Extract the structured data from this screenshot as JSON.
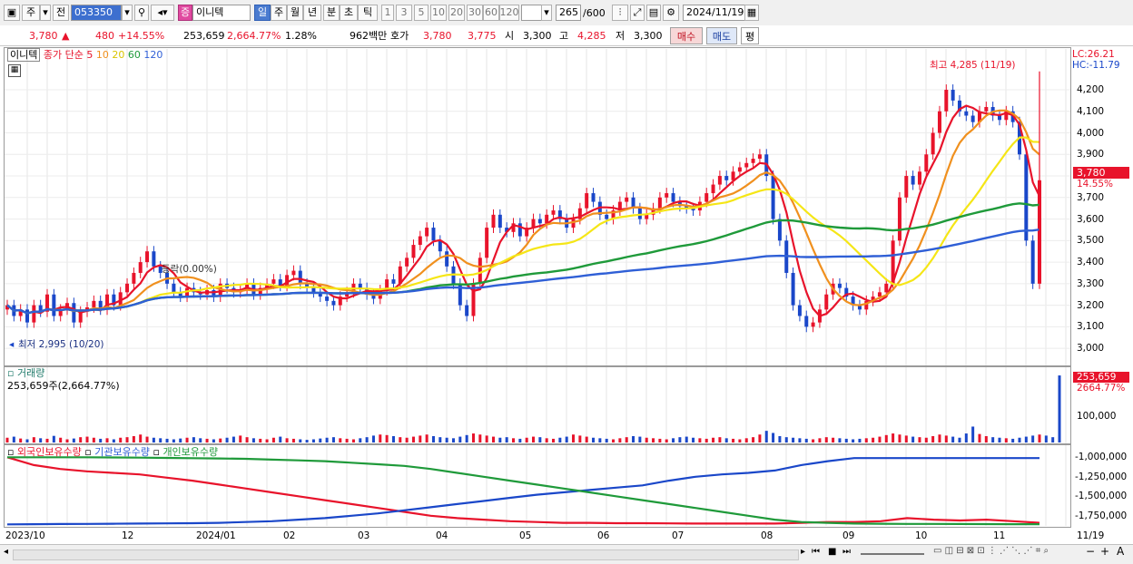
{
  "toolbar": {
    "mode_label": "주",
    "prev_label": "전",
    "code_value": "053350",
    "name_badge": "증",
    "name_value": "이니텍",
    "period_tabs": [
      "일",
      "주",
      "월",
      "년",
      "분",
      "초",
      "틱"
    ],
    "period_nums": [
      "1",
      "3",
      "5",
      "10",
      "20",
      "30",
      "60",
      "120"
    ],
    "count_value": "265",
    "count_total": "/600",
    "date_value": "2024/11/19"
  },
  "info": {
    "price": "3,780",
    "change": "480",
    "change_pct": "+14.55%",
    "volume": "253,659",
    "volume_pct": "2,664.77%",
    "turnover": "1.28%",
    "amount": "962백만",
    "quote_label": "호가",
    "quote_ask": "3,780",
    "quote_bid": "3,775",
    "open_label": "시",
    "open": "3,300",
    "high_label": "고",
    "high": "4,285",
    "low_label": "저",
    "low": "3,300",
    "buy_label": "매수",
    "sell_label": "매도",
    "avg_label": "평"
  },
  "price_pane": {
    "name": "이니텍",
    "ma_label": "종가 단순",
    "ma_periods": [
      "5",
      "10",
      "20",
      "60",
      "120"
    ],
    "lc": "LC:26.21",
    "hc": "HC:-11.79",
    "high_note": "최고 4,285 (11/19)",
    "low_note": "최저 2,995 (10/20)",
    "mid_note": "등락(0.00%)",
    "yticks": [
      "4,200",
      "4,100",
      "4,000",
      "3,900",
      "3,800",
      "3,700",
      "3,600",
      "3,500",
      "3,400",
      "3,300",
      "3,200",
      "3,100",
      "3,000"
    ],
    "cur_price_tag": "3,780",
    "cur_pct_tag": "14.55%"
  },
  "volume_pane": {
    "title": "거래량",
    "value_text": "253,659주(2,664.77%)",
    "ytick": "100,000",
    "cur_tag": "253,659",
    "cur_pct_tag": "2664.77%"
  },
  "holding_pane": {
    "legend": [
      "외국인보유수량",
      "기관보유수량",
      "개인보유수량"
    ],
    "yticks": [
      "-1,000,000",
      "-1,250,000",
      "-1,500,000",
      "-1,750,000"
    ]
  },
  "xaxis": [
    "2023/10",
    "12",
    "2024/01",
    "02",
    "03",
    "04",
    "05",
    "06",
    "07",
    "08",
    "09",
    "10",
    "11",
    "11/19"
  ],
  "colors": {
    "up": "#e8132b",
    "down": "#1a47c9",
    "ma5": "#e8132b",
    "ma10": "#f0901e",
    "ma20": "#f5e616",
    "ma60": "#1f9a3a",
    "ma120": "#2f5fd6"
  },
  "chart_data": {
    "type": "candlestick",
    "price_ylim": [
      2950,
      4280
    ],
    "close_series": [
      3200,
      3150,
      3180,
      3120,
      3200,
      3170,
      3250,
      3150,
      3180,
      3210,
      3120,
      3170,
      3190,
      3220,
      3180,
      3250,
      3200,
      3260,
      3300,
      3350,
      3400,
      3450,
      3380,
      3350,
      3300,
      3260,
      3240,
      3280,
      3260,
      3250,
      3270,
      3240,
      3300,
      3280,
      3260,
      3270,
      3300,
      3250,
      3280,
      3300,
      3320,
      3290,
      3340,
      3360,
      3300,
      3280,
      3260,
      3240,
      3220,
      3200,
      3240,
      3260,
      3300,
      3280,
      3250,
      3230,
      3270,
      3320,
      3300,
      3380,
      3420,
      3480,
      3520,
      3560,
      3500,
      3450,
      3380,
      3300,
      3200,
      3150,
      3300,
      3420,
      3560,
      3620,
      3560,
      3540,
      3580,
      3520,
      3560,
      3600,
      3580,
      3620,
      3640,
      3600,
      3560,
      3600,
      3650,
      3720,
      3680,
      3620,
      3600,
      3640,
      3680,
      3700,
      3650,
      3600,
      3620,
      3650,
      3700,
      3720,
      3680,
      3660,
      3650,
      3640,
      3680,
      3720,
      3760,
      3800,
      3780,
      3820,
      3840,
      3860,
      3880,
      3900,
      3800,
      3600,
      3500,
      3350,
      3200,
      3150,
      3100,
      3120,
      3180,
      3250,
      3300,
      3280,
      3240,
      3200,
      3180,
      3220,
      3240,
      3260,
      3300,
      3500,
      3700,
      3800,
      3760,
      3820,
      3900,
      4000,
      4100,
      4200,
      4150,
      4100,
      4080,
      4050,
      4100,
      4120,
      4080,
      4060,
      4100,
      4050,
      3900,
      3500,
      3300,
      3780
    ],
    "volume_series": [
      18,
      22,
      15,
      12,
      20,
      16,
      14,
      25,
      18,
      12,
      15,
      20,
      22,
      18,
      14,
      16,
      12,
      18,
      20,
      24,
      30,
      22,
      18,
      16,
      14,
      12,
      15,
      18,
      20,
      16,
      14,
      12,
      15,
      18,
      22,
      26,
      20,
      16,
      14,
      12,
      18,
      22,
      16,
      14,
      12,
      10,
      12,
      15,
      18,
      20,
      16,
      14,
      12,
      16,
      20,
      26,
      30,
      28,
      24,
      20,
      18,
      22,
      26,
      30,
      24,
      20,
      18,
      16,
      22,
      28,
      34,
      30,
      26,
      22,
      18,
      20,
      16,
      14,
      18,
      22,
      20,
      16,
      14,
      18,
      22,
      30,
      26,
      22,
      18,
      16,
      14,
      12,
      16,
      20,
      24,
      22,
      18,
      16,
      14,
      12,
      16,
      20,
      22,
      18,
      16,
      14,
      18,
      20,
      16,
      14,
      12,
      16,
      20,
      30,
      44,
      36,
      24,
      20,
      18,
      16,
      14,
      12,
      16,
      20,
      18,
      16,
      14,
      12,
      14,
      16,
      18,
      22,
      28,
      34,
      30,
      26,
      22,
      20,
      18,
      24,
      30,
      26,
      22,
      18,
      34,
      60,
      32,
      24,
      20,
      18,
      16,
      14,
      18,
      22,
      26,
      30,
      26,
      20,
      253
    ],
    "holding_series": [
      {
        "name": "외국인보유수량",
        "ylim": [
          -1880000,
          -950000
        ],
        "values": [
          -1000000,
          -1100000,
          -1150000,
          -1180000,
          -1200000,
          -1220000,
          -1260000,
          -1300000,
          -1350000,
          -1400000,
          -1450000,
          -1500000,
          -1550000,
          -1600000,
          -1650000,
          -1700000,
          -1750000,
          -1780000,
          -1800000,
          -1820000,
          -1830000,
          -1840000,
          -1840000,
          -1845000,
          -1845000,
          -1848000,
          -1850000,
          -1850000,
          -1850000,
          -1850000,
          -1840000,
          -1830000,
          -1830000,
          -1820000,
          -1780000,
          -1800000,
          -1810000,
          -1800000,
          -1820000,
          -1840000
        ]
      },
      {
        "name": "기관보유수량",
        "ylim": [
          -1880000,
          -950000
        ],
        "values": [
          -1860000,
          -1858000,
          -1856000,
          -1854000,
          -1852000,
          -1850000,
          -1848000,
          -1845000,
          -1840000,
          -1830000,
          -1820000,
          -1800000,
          -1780000,
          -1750000,
          -1720000,
          -1680000,
          -1640000,
          -1600000,
          -1560000,
          -1520000,
          -1480000,
          -1450000,
          -1420000,
          -1390000,
          -1360000,
          -1300000,
          -1250000,
          -1220000,
          -1200000,
          -1170000,
          -1100000,
          -1050000,
          -1010000,
          -1010000,
          -1010000,
          -1010000,
          -1010000,
          -1010000,
          -1010000,
          -1010000
        ]
      },
      {
        "name": "개인보유수량",
        "ylim": [
          -1880000,
          -950000
        ],
        "values": [
          -1000000,
          -1000000,
          -1000000,
          -1000000,
          -1002000,
          -1005000,
          -1008000,
          -1012000,
          -1015000,
          -1020000,
          -1030000,
          -1040000,
          -1050000,
          -1070000,
          -1090000,
          -1110000,
          -1150000,
          -1200000,
          -1250000,
          -1300000,
          -1350000,
          -1400000,
          -1450000,
          -1500000,
          -1550000,
          -1600000,
          -1650000,
          -1700000,
          -1750000,
          -1800000,
          -1830000,
          -1840000,
          -1850000,
          -1852000,
          -1854000,
          -1855000,
          -1856000,
          -1857000,
          -1858000,
          -1858000
        ]
      }
    ]
  }
}
